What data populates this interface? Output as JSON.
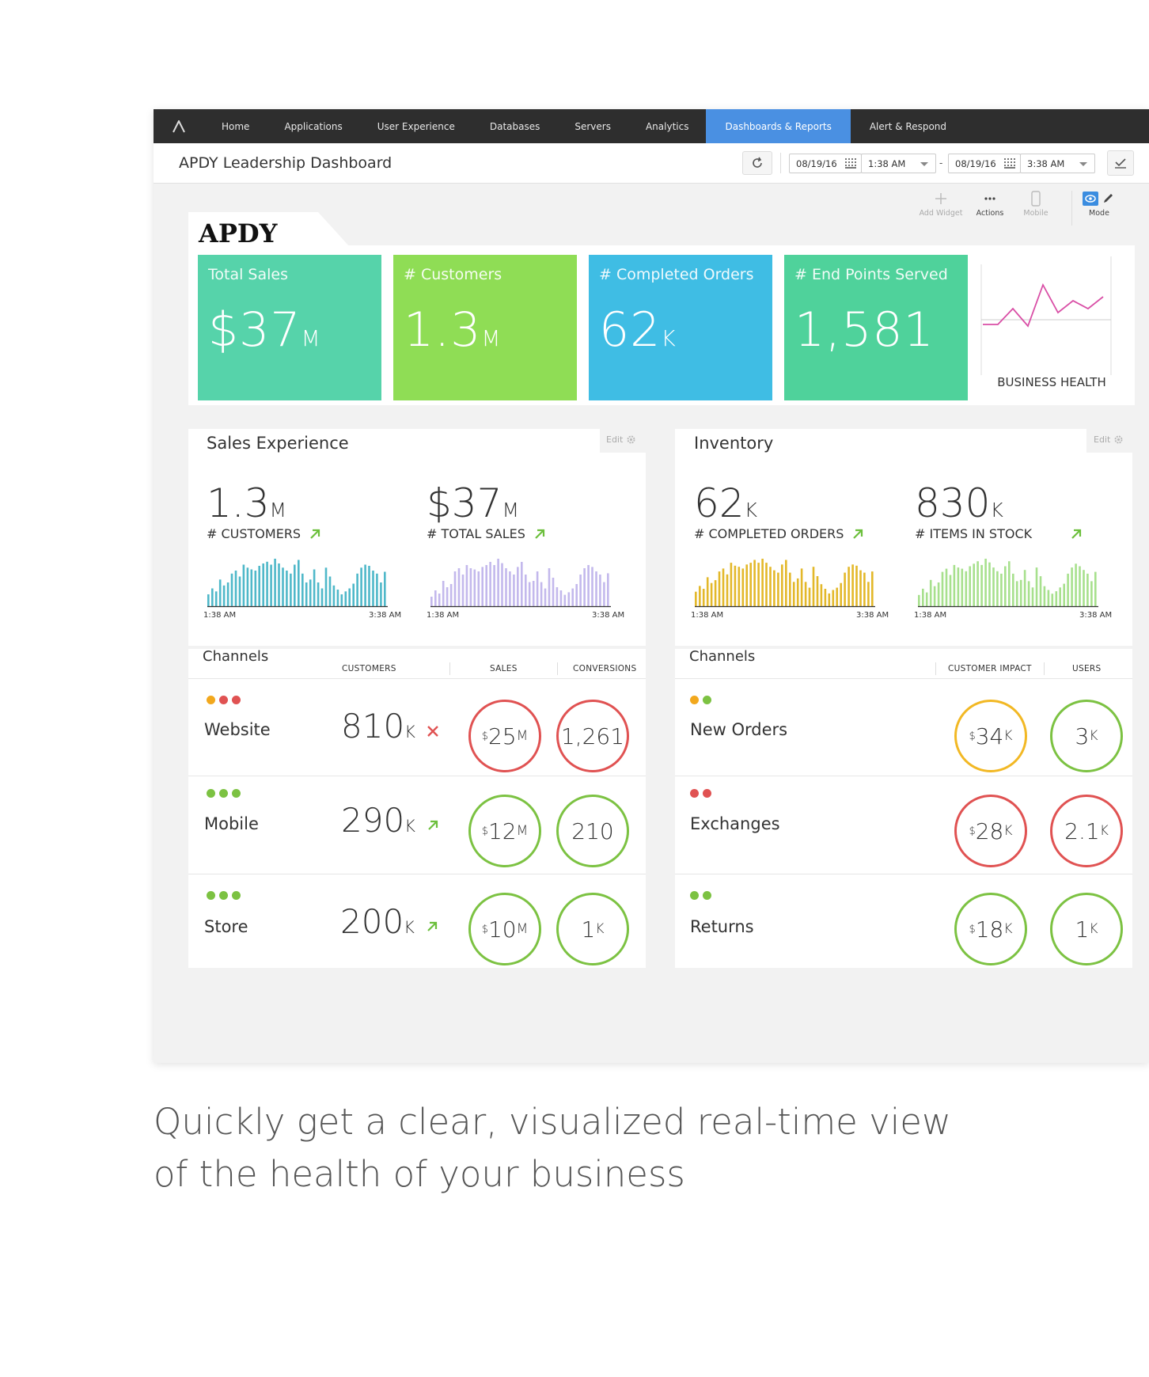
{
  "nav": {
    "items": [
      "Home",
      "Applications",
      "User Experience",
      "Databases",
      "Servers",
      "Analytics",
      "Dashboards & Reports",
      "Alert & Respond"
    ],
    "active_index": 6
  },
  "titlebar": {
    "title": "APDY Leadership Dashboard",
    "from_date": "08/19/16",
    "from_time": "1:38 AM",
    "to_date": "08/19/16",
    "to_time": "3:38 AM",
    "separator": "-"
  },
  "toolbar": {
    "add_widget": "Add Widget",
    "actions": "Actions",
    "mobile": "Mobile",
    "mode": "Mode"
  },
  "brand": {
    "name": "APDY"
  },
  "kpis": [
    {
      "label": "Total Sales",
      "value": "$37",
      "unit": "M",
      "color": "#56d3aa"
    },
    {
      "label": "# Customers",
      "value": "1.3",
      "unit": "M",
      "color": "#8fdd55"
    },
    {
      "label": "# Completed Orders",
      "value": "62",
      "unit": "K",
      "color": "#3fbde4"
    },
    {
      "label": "# End Points Served",
      "value": "1,581",
      "unit": "",
      "color": "#4fd29b"
    }
  ],
  "business_health": {
    "label": "BUSINESS HEALTH",
    "values": [
      10,
      10,
      30,
      8,
      60,
      25,
      40,
      30,
      45
    ]
  },
  "sales_experience": {
    "title": "Sales Experience",
    "edit": "Edit",
    "metrics": [
      {
        "value": "1.3",
        "unit": "M",
        "label": "# CUSTOMERS",
        "trend": "up"
      },
      {
        "value": "$37",
        "unit": "M",
        "label": "# TOTAL SALES",
        "trend": "up"
      }
    ],
    "sparks": [
      {
        "color": "#4fb8c9",
        "start": "1:38 AM",
        "end": "3:38 AM",
        "values": [
          20,
          30,
          25,
          45,
          35,
          40,
          55,
          60,
          50,
          70,
          65,
          62,
          60,
          68,
          72,
          75,
          70,
          80,
          72,
          65,
          60,
          55,
          70,
          78,
          55,
          40,
          45,
          62,
          40,
          30,
          65,
          50,
          35,
          28,
          20,
          25,
          30,
          38,
          55,
          65,
          70,
          68,
          60,
          55,
          40,
          58
        ]
      },
      {
        "color": "#c3b8ec",
        "start": "1:38 AM",
        "end": "3:38 AM",
        "values": [
          15,
          25,
          20,
          40,
          30,
          35,
          55,
          60,
          50,
          65,
          60,
          58,
          55,
          62,
          65,
          70,
          65,
          75,
          68,
          60,
          55,
          50,
          62,
          70,
          50,
          38,
          40,
          55,
          38,
          28,
          60,
          45,
          30,
          25,
          18,
          22,
          28,
          35,
          50,
          60,
          65,
          62,
          55,
          50,
          38,
          52
        ]
      }
    ]
  },
  "inventory": {
    "title": "Inventory",
    "edit": "Edit",
    "metrics": [
      {
        "value": "62",
        "unit": "K",
        "label": "# COMPLETED ORDERS",
        "trend": "up"
      },
      {
        "value": "830",
        "unit": "K",
        "label": "# ITEMS IN STOCK",
        "trend": "up"
      }
    ],
    "sparks": [
      {
        "color": "#e3b82a",
        "start": "1:38 AM",
        "end": "3:38 AM",
        "values": [
          25,
          35,
          30,
          50,
          40,
          45,
          60,
          65,
          55,
          75,
          70,
          68,
          65,
          72,
          75,
          80,
          75,
          82,
          75,
          68,
          62,
          58,
          72,
          80,
          58,
          42,
          48,
          65,
          42,
          32,
          68,
          52,
          38,
          30,
          22,
          28,
          32,
          40,
          58,
          68,
          72,
          70,
          62,
          58,
          42,
          60
        ]
      },
      {
        "color": "#a7e08d",
        "start": "1:38 AM",
        "end": "3:38 AM",
        "values": [
          18,
          28,
          22,
          42,
          32,
          38,
          55,
          60,
          50,
          66,
          62,
          60,
          56,
          64,
          68,
          72,
          66,
          76,
          70,
          62,
          56,
          52,
          64,
          72,
          52,
          40,
          42,
          58,
          40,
          30,
          62,
          48,
          32,
          26,
          20,
          24,
          30,
          36,
          52,
          62,
          68,
          64,
          58,
          52,
          40,
          55
        ]
      }
    ]
  },
  "sales_channels": {
    "title": "Channels",
    "headers": [
      "CUSTOMERS",
      "SALES",
      "CONVERSIONS"
    ],
    "rows": [
      {
        "name": "Website",
        "dots": [
          "#f2a81d",
          "#e05252",
          "#e05252"
        ],
        "value": "810",
        "unit": "K",
        "trend": "down",
        "sales": {
          "pre": "$",
          "value": "25",
          "unit": "M",
          "color": "#e05252"
        },
        "conv": {
          "value": "1,261",
          "unit": "",
          "color": "#e05252"
        }
      },
      {
        "name": "Mobile",
        "dots": [
          "#7cc242",
          "#7cc242",
          "#7cc242"
        ],
        "value": "290",
        "unit": "K",
        "trend": "up",
        "sales": {
          "pre": "$",
          "value": "12",
          "unit": "M",
          "color": "#7cc242"
        },
        "conv": {
          "value": "210",
          "unit": "",
          "color": "#7cc242"
        }
      },
      {
        "name": "Store",
        "dots": [
          "#7cc242",
          "#7cc242",
          "#7cc242"
        ],
        "value": "200",
        "unit": "K",
        "trend": "up",
        "sales": {
          "pre": "$",
          "value": "10",
          "unit": "M",
          "color": "#7cc242"
        },
        "conv": {
          "value": "1",
          "unit": "K",
          "color": "#7cc242"
        }
      }
    ]
  },
  "inventory_channels": {
    "title": "Channels",
    "headers": [
      "CUSTOMER IMPACT",
      "USERS"
    ],
    "rows": [
      {
        "name": "New Orders",
        "dots": [
          "#f2a81d",
          "#7cc242"
        ],
        "impact": {
          "pre": "$",
          "value": "34",
          "unit": "K",
          "color": "#f2b824"
        },
        "users": {
          "value": "3",
          "unit": "K",
          "color": "#7cc242"
        }
      },
      {
        "name": "Exchanges",
        "dots": [
          "#e05252",
          "#e05252"
        ],
        "impact": {
          "pre": "$",
          "value": "28",
          "unit": "K",
          "color": "#e05252"
        },
        "users": {
          "value": "2.1",
          "unit": "K",
          "color": "#e05252"
        }
      },
      {
        "name": "Returns",
        "dots": [
          "#7cc242",
          "#7cc242"
        ],
        "impact": {
          "pre": "$",
          "value": "18",
          "unit": "K",
          "color": "#7cc242"
        },
        "users": {
          "value": "1",
          "unit": "K",
          "color": "#7cc242"
        }
      }
    ]
  },
  "tagline": {
    "line1": "Quickly get a clear, visualized real-time view",
    "line2": "of the health of your business"
  }
}
